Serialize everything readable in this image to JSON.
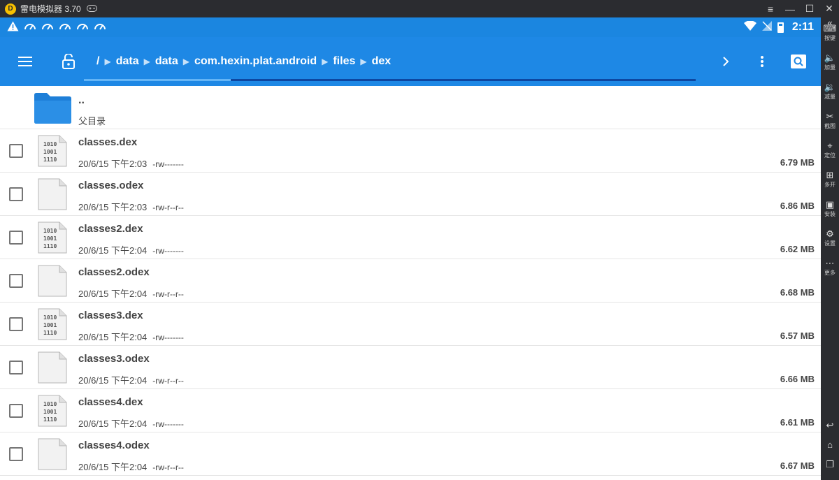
{
  "emulator": {
    "title": "雷电模拟器 3.70",
    "window_buttons": [
      "≡",
      "—",
      "☐",
      "✕"
    ],
    "side_panel": [
      {
        "icon": "keyboard-icon",
        "label": "按键"
      },
      {
        "icon": "volume-up-icon",
        "label": "加量"
      },
      {
        "icon": "volume-down-icon",
        "label": "减量"
      },
      {
        "icon": "scissors-icon",
        "label": "截图"
      },
      {
        "icon": "location-icon",
        "label": "定位"
      },
      {
        "icon": "multi-open-icon",
        "label": "多开"
      },
      {
        "icon": "apk-install-icon",
        "label": "安装"
      },
      {
        "icon": "gear-icon",
        "label": "设置"
      },
      {
        "icon": "more-icon",
        "label": "更多"
      }
    ]
  },
  "statusbar": {
    "time": "2:11"
  },
  "toolbar": {
    "breadcrumbs": [
      "/",
      "data",
      "data",
      "com.hexin.plat.android",
      "files",
      "dex"
    ],
    "progress": 0.24
  },
  "parent": {
    "name": "..",
    "label": "父目录"
  },
  "files": [
    {
      "name": "classes.dex",
      "date": "20/6/15 下午2:03",
      "perm": "-rw-------",
      "size": "6.79 MB",
      "type": "binary"
    },
    {
      "name": "classes.odex",
      "date": "20/6/15 下午2:03",
      "perm": "-rw-r--r--",
      "size": "6.86 MB",
      "type": "blank"
    },
    {
      "name": "classes2.dex",
      "date": "20/6/15 下午2:04",
      "perm": "-rw-------",
      "size": "6.62 MB",
      "type": "binary"
    },
    {
      "name": "classes2.odex",
      "date": "20/6/15 下午2:04",
      "perm": "-rw-r--r--",
      "size": "6.68 MB",
      "type": "blank"
    },
    {
      "name": "classes3.dex",
      "date": "20/6/15 下午2:04",
      "perm": "-rw-------",
      "size": "6.57 MB",
      "type": "binary"
    },
    {
      "name": "classes3.odex",
      "date": "20/6/15 下午2:04",
      "perm": "-rw-r--r--",
      "size": "6.66 MB",
      "type": "blank"
    },
    {
      "name": "classes4.dex",
      "date": "20/6/15 下午2:04",
      "perm": "-rw-------",
      "size": "6.61 MB",
      "type": "binary"
    },
    {
      "name": "classes4.odex",
      "date": "20/6/15 下午2:04",
      "perm": "-rw-r--r--",
      "size": "6.67 MB",
      "type": "blank"
    }
  ],
  "binary_icon_lines": [
    "1010",
    "1001",
    "1110"
  ]
}
